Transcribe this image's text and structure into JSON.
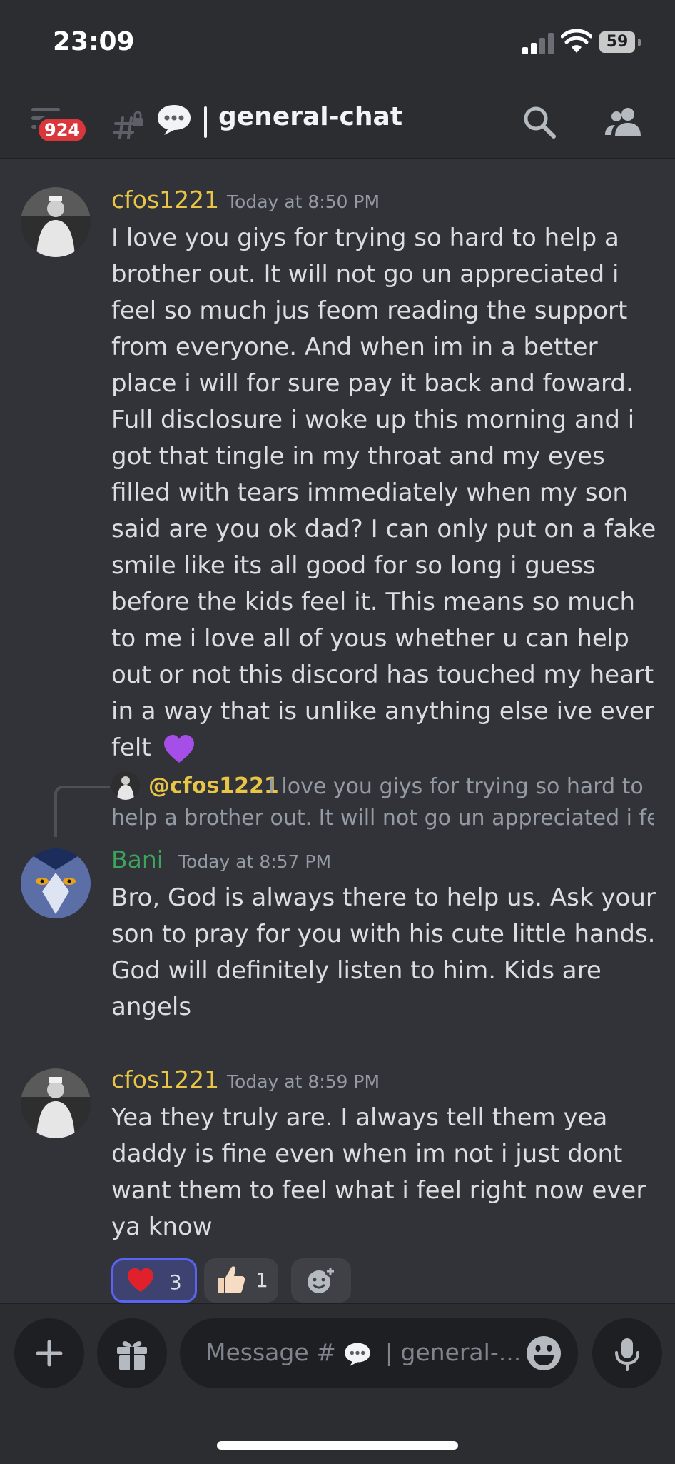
{
  "status_bar": {
    "time": "23:09",
    "battery": "59"
  },
  "header": {
    "unread_badge": "924",
    "channel_name": "general-chat"
  },
  "messages": [
    {
      "username": "cfos1221",
      "timestamp": "Today at 8:50 PM",
      "text": "I love you giys for trying so hard to help a brother out. It will not go un appreciated i feel so much jus feom reading the support from everyone. And when im in a better place i will for sure pay it back and foward. Full disclosure i woke up this morning and i got that tingle in my throat and my eyes filled with tears immediately when my son said are you ok dad? I can only put on  a fake smile like its all good for so long i guess before the kids feel it. This means so much to me i love all of yous whether u can help out or not this discord has touched my heart in a way that is unlike anything else ive ever felt",
      "trailing_emoji": "purple-heart"
    },
    {
      "reply": {
        "mention": "@cfos1221",
        "preview_line1": "I love you giys for trying so hard to",
        "preview_line2": "help a brother out. It will not go un appreciated i fe..."
      },
      "username": "Bani",
      "timestamp": "Today at 8:57 PM",
      "text": "Bro, God is always there to help us. Ask your son to pray for you with his cute little hands. God will definitely listen to him. Kids are angels"
    },
    {
      "username": "cfos1221",
      "timestamp": "Today at 8:59 PM",
      "text": "Yea they truly are. I always tell them yea daddy is fine even when im not i just dont want them to feel what i feel right now ever ya know",
      "reactions": [
        {
          "emoji": "red-heart",
          "count": "3",
          "active": true
        },
        {
          "emoji": "thumbs-up",
          "count": "1",
          "active": false
        }
      ]
    }
  ],
  "composer": {
    "placeholder_prefix": "Message #",
    "placeholder_suffix": "| general-..."
  },
  "colors": {
    "background": "#313338",
    "bar": "#2b2d31",
    "username_gold": "#e8c547",
    "username_green": "#3ba55c",
    "badge_red": "#da373c",
    "reaction_active": "#5865f2"
  }
}
